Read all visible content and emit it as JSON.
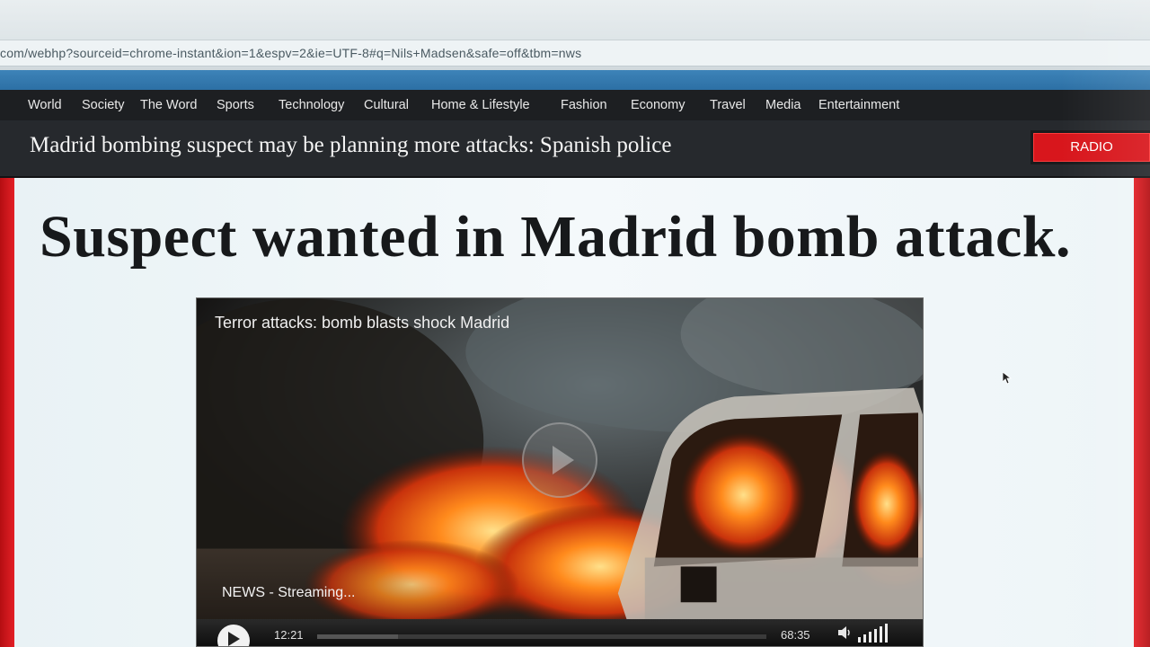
{
  "browser": {
    "url": "com/webhp?sourceid=chrome-instant&ion=1&espv=2&ie=UTF-8#q=Nils+Madsen&safe=off&tbm=nws"
  },
  "nav": {
    "items": [
      "World",
      "Society",
      "The Word",
      "Sports",
      "Technology",
      "Cultural",
      "Home & Lifestyle",
      "Fashion",
      "Economy",
      "Travel",
      "Media",
      "Entertainment"
    ]
  },
  "headline": {
    "text": "Madrid bombing suspect may be planning more attacks: Spanish police",
    "radio_label": "RADIO"
  },
  "article": {
    "title": "Suspect wanted in Madrid bomb attack."
  },
  "video": {
    "title": "Terror attacks: bomb blasts shock Madrid",
    "status": "NEWS - Streaming...",
    "time_current": "12:21",
    "time_total": "68:35",
    "progress": 0.18
  },
  "colors": {
    "accent_red": "#d8161c",
    "nav_bg": "#1d1f22",
    "headline_bg": "#26292d",
    "browser_blue": "#2b6ea3"
  },
  "icons": [
    "play-icon",
    "play-overlay-icon",
    "volume-icon",
    "volume-level-icon",
    "mouse-cursor-icon"
  ]
}
